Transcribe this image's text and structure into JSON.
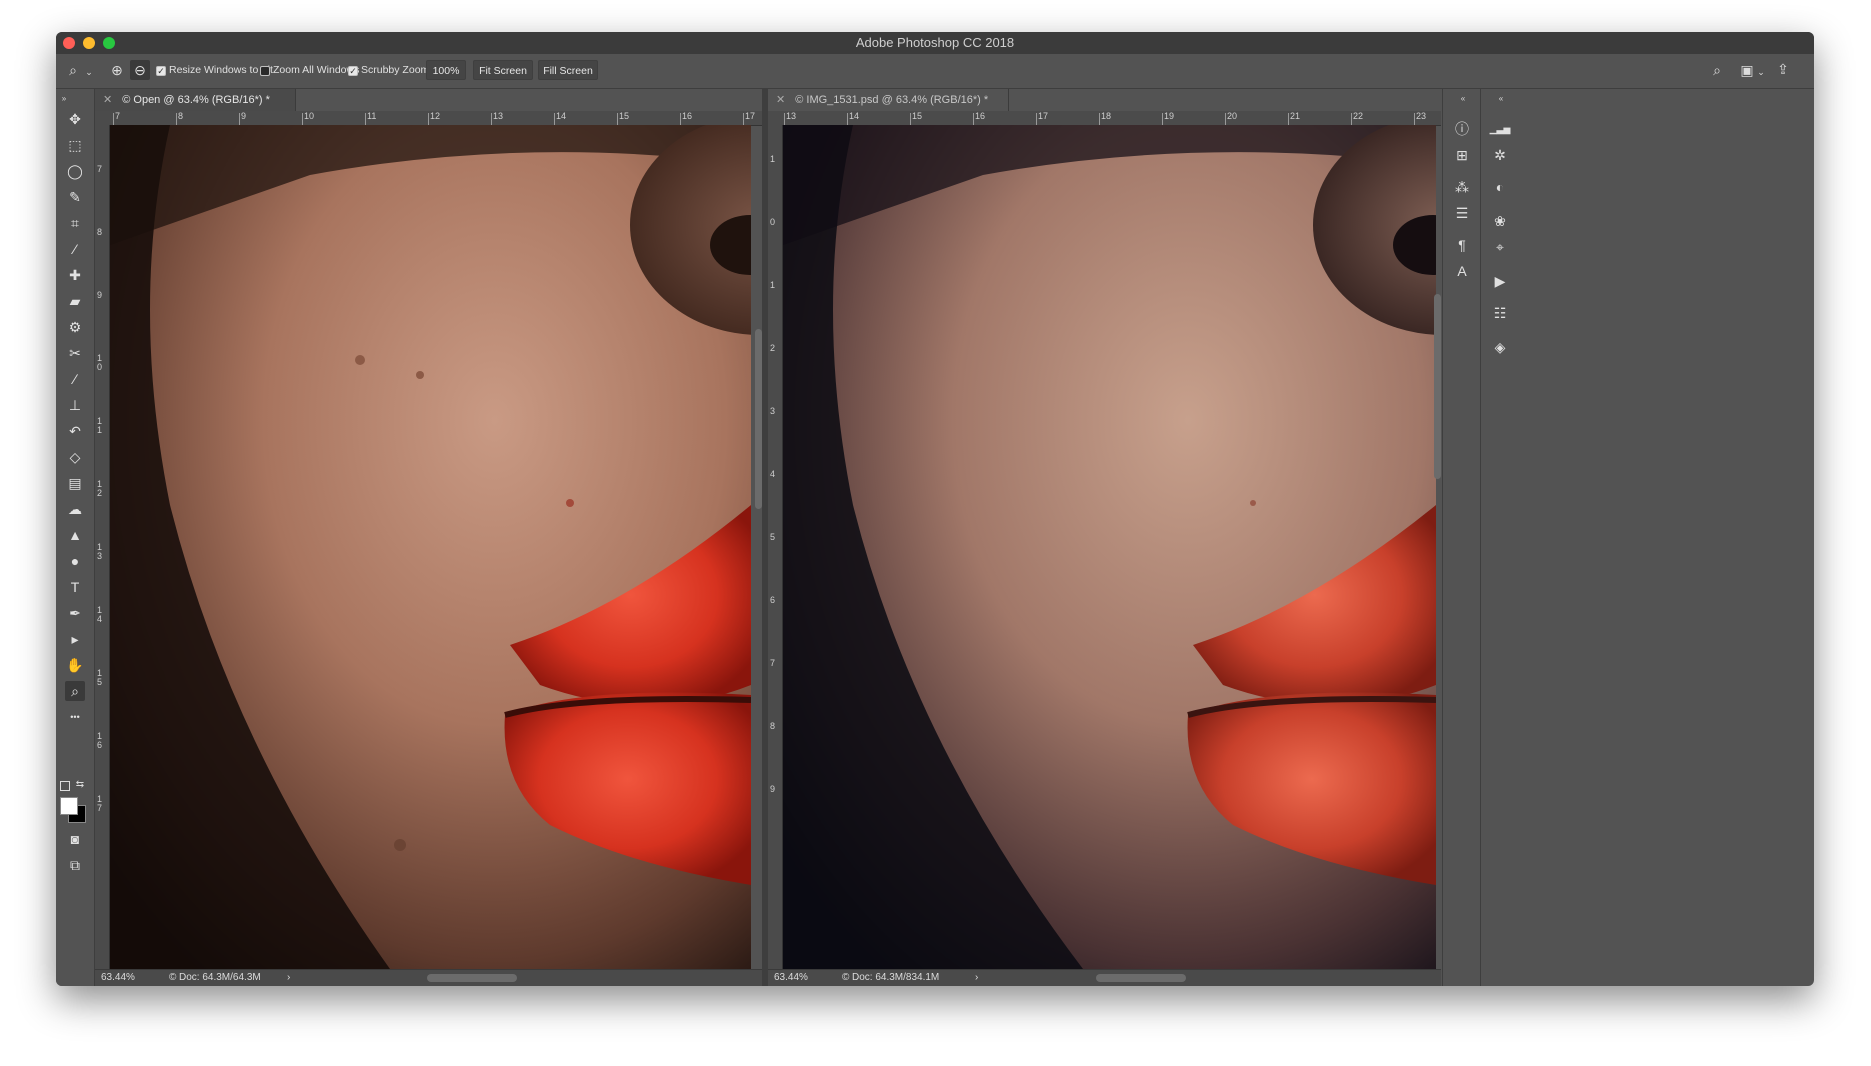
{
  "app": {
    "title": "Adobe Photoshop CC 2018"
  },
  "colors": {
    "close": "#ff5f57",
    "minimize": "#febc2e",
    "zoom": "#28c840",
    "lip": "#d6321f",
    "skin": "#b98874"
  },
  "options": {
    "resize_windows": "Resize Windows to Fit",
    "zoom_all": "Zoom All Windows",
    "scrubby_zoom": "Scrubby Zoom",
    "zoom_value": "100%",
    "fit_screen": "Fit Screen",
    "fill_screen": "Fill Screen"
  },
  "tools": [
    {
      "name": "move-tool-icon",
      "glyph": "✥"
    },
    {
      "name": "marquee-tool-icon",
      "glyph": "⬚"
    },
    {
      "name": "lasso-tool-icon",
      "glyph": "◯"
    },
    {
      "name": "quick-select-tool-icon",
      "glyph": "✎"
    },
    {
      "name": "crop-tool-icon",
      "glyph": "⌗"
    },
    {
      "name": "eyedropper-tool-icon",
      "glyph": "⁄"
    },
    {
      "name": "spot-healing-tool-icon",
      "glyph": "✚"
    },
    {
      "name": "healing-brush-tool-icon",
      "glyph": "▰"
    },
    {
      "name": "patch-tool-icon",
      "glyph": "⚙"
    },
    {
      "name": "content-aware-move-tool-icon",
      "glyph": "✂"
    },
    {
      "name": "brush-tool-icon",
      "glyph": "∕"
    },
    {
      "name": "clone-stamp-tool-icon",
      "glyph": "⊥"
    },
    {
      "name": "history-brush-tool-icon",
      "glyph": "↶"
    },
    {
      "name": "eraser-tool-icon",
      "glyph": "◇"
    },
    {
      "name": "gradient-tool-icon",
      "glyph": "▤"
    },
    {
      "name": "blur-tool-icon",
      "glyph": "☁"
    },
    {
      "name": "sharpen-tool-icon",
      "glyph": "▲"
    },
    {
      "name": "dodge-tool-icon",
      "glyph": "●"
    },
    {
      "name": "type-tool-icon",
      "glyph": "T"
    },
    {
      "name": "pen-tool-icon",
      "glyph": "✒"
    },
    {
      "name": "path-select-tool-icon",
      "glyph": "▸"
    },
    {
      "name": "hand-tool-icon",
      "glyph": "✋"
    },
    {
      "name": "zoom-tool-icon",
      "glyph": "⌕"
    },
    {
      "name": "more-tools-icon",
      "glyph": "•••"
    }
  ],
  "doc_left": {
    "tab": "Open @ 63.4% (RGB/16*) *",
    "ruler_top": [
      "7",
      "8",
      "9",
      "10",
      "11",
      "12",
      "13",
      "14",
      "15",
      "16",
      "17"
    ],
    "ruler_left": [
      "7",
      "8",
      "9",
      "1\n0",
      "1\n1",
      "1\n2",
      "1\n3",
      "1\n4",
      "1\n5",
      "1\n6",
      "1\n7"
    ],
    "zoom": "63.44%",
    "doc": "Doc: 64.3M/64.3M"
  },
  "doc_right": {
    "tab": "IMG_1531.psd @ 63.4% (RGB/16*) *",
    "ruler_top": [
      "13",
      "14",
      "15",
      "16",
      "17",
      "18",
      "19",
      "20",
      "21",
      "22",
      "23"
    ],
    "ruler_left": [
      "1",
      "0",
      "1",
      "2",
      "3",
      "4",
      "5",
      "6",
      "7",
      "8",
      "9"
    ],
    "zoom": "63.44%",
    "doc": "Doc: 64.3M/834.1M"
  },
  "panel_col1": [
    {
      "name": "info-icon",
      "glyph": "ⓘ"
    },
    {
      "name": "clone-source-icon",
      "glyph": "⊞"
    },
    {
      "name": "brush-settings-icon",
      "glyph": "⁂"
    },
    {
      "name": "properties-icon",
      "glyph": "☰"
    },
    {
      "name": "paragraph-icon",
      "glyph": "¶"
    },
    {
      "name": "character-icon",
      "glyph": "A"
    }
  ],
  "panel_col2": [
    {
      "name": "histogram-icon",
      "glyph": "▁▃▅"
    },
    {
      "name": "navigator-icon",
      "glyph": "✲"
    },
    {
      "name": "adjustments-icon",
      "glyph": "◐"
    },
    {
      "name": "channels-icon",
      "glyph": "❀"
    },
    {
      "name": "paths-icon",
      "glyph": "⌖"
    },
    {
      "name": "actions-icon",
      "glyph": "▶"
    },
    {
      "name": "libraries-icon",
      "glyph": "☷"
    },
    {
      "name": "layers-icon",
      "glyph": "◈"
    }
  ]
}
